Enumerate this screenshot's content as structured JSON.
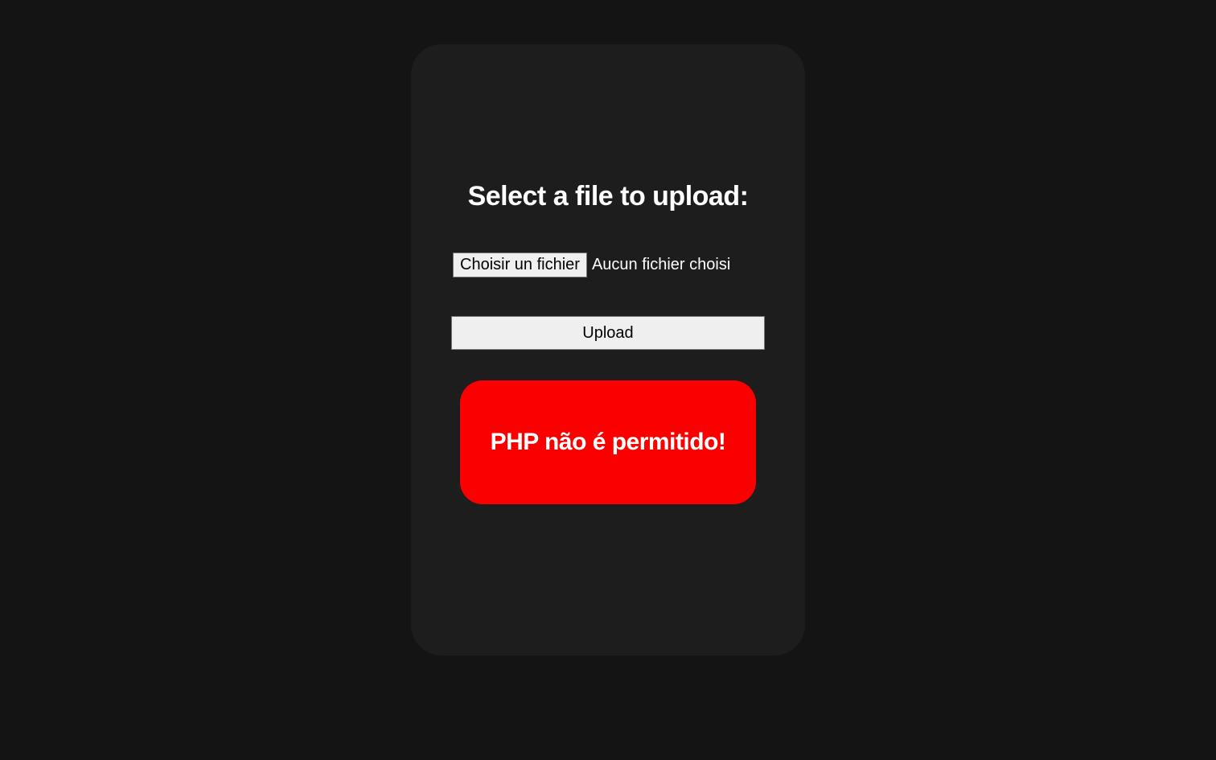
{
  "upload": {
    "title": "Select a file to upload:",
    "choose_button": "Choisir un fichier",
    "file_status": "Aucun fichier choisi",
    "upload_button": "Upload",
    "error_message": "PHP não é permitido!"
  }
}
